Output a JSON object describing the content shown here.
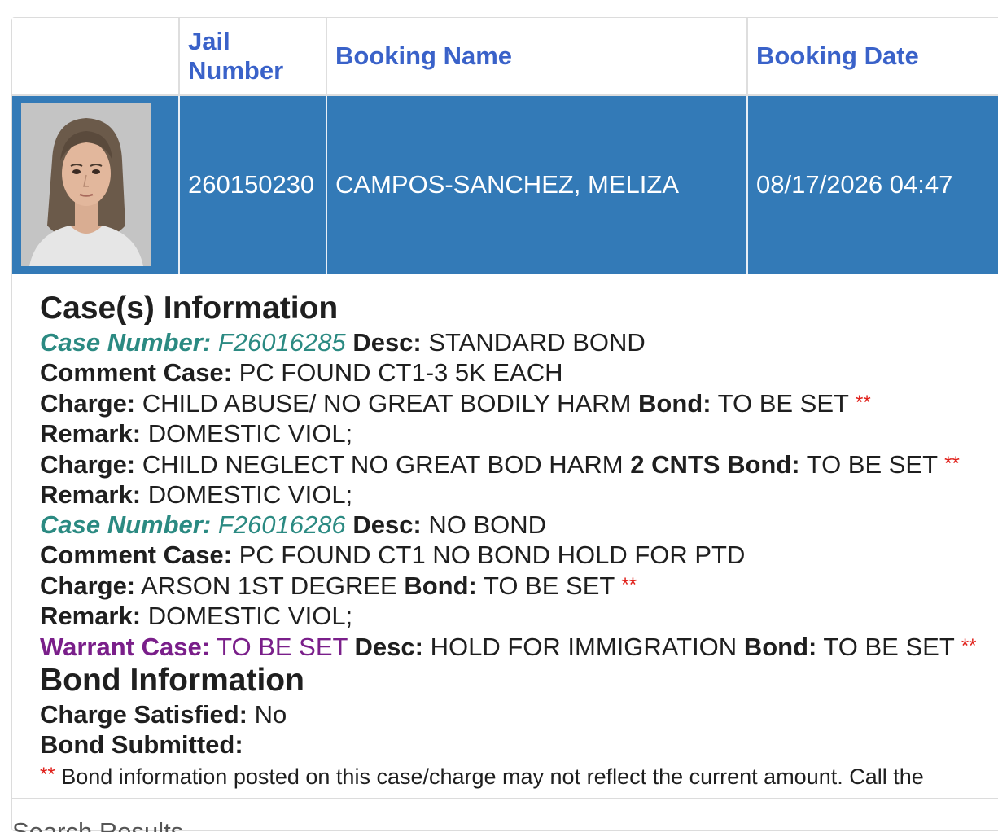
{
  "table": {
    "headers": [
      "",
      "Jail Number",
      "Booking Name",
      "Booking Date"
    ],
    "row": {
      "jail_number": "260150230",
      "booking_name": "CAMPOS-SANCHEZ, MELIZA",
      "booking_date": "08/17/2026 04:47"
    }
  },
  "cases_section": {
    "title": "Case(s) Information",
    "lines": [
      {
        "kind": "case",
        "label": "Case Number:",
        "value": "F26016285",
        "desc_label": "Desc:",
        "desc": "STANDARD BOND"
      },
      {
        "kind": "comment",
        "label": "Comment Case:",
        "value": "PC FOUND CT1-3 5K EACH"
      },
      {
        "kind": "charge",
        "label": "Charge:",
        "value": "CHILD ABUSE/ NO GREAT BODILY HARM",
        "counts": "",
        "bond_label": "Bond:",
        "bond": "TO BE SET",
        "stars": "**"
      },
      {
        "kind": "remark",
        "label": "Remark:",
        "value": "DOMESTIC VIOL;"
      },
      {
        "kind": "charge",
        "label": "Charge:",
        "value": "CHILD NEGLECT NO GREAT BOD HARM",
        "counts": "2 CNTS",
        "bond_label": "Bond:",
        "bond": "TO BE SET",
        "stars": "**"
      },
      {
        "kind": "remark",
        "label": "Remark:",
        "value": "DOMESTIC VIOL;"
      },
      {
        "kind": "case",
        "label": "Case Number:",
        "value": "F26016286",
        "desc_label": "Desc:",
        "desc": "NO BOND"
      },
      {
        "kind": "comment",
        "label": "Comment Case:",
        "value": "PC FOUND CT1 NO BOND HOLD FOR PTD"
      },
      {
        "kind": "charge",
        "label": "Charge:",
        "value": "ARSON 1ST DEGREE",
        "counts": "",
        "bond_label": "Bond:",
        "bond": "TO BE SET",
        "stars": "**"
      },
      {
        "kind": "remark",
        "label": "Remark:",
        "value": "DOMESTIC VIOL;"
      },
      {
        "kind": "warrant",
        "label": "Warrant Case:",
        "value": "TO BE SET",
        "desc_label": "Desc:",
        "desc": "HOLD FOR IMMIGRATION",
        "bond_label": "Bond:",
        "bond": "TO BE SET",
        "stars": "**"
      }
    ]
  },
  "bond_section": {
    "title": "Bond Information",
    "charge_satisfied_label": "Charge Satisfied:",
    "charge_satisfied": "No",
    "bond_submitted_label": "Bond Submitted:",
    "bond_submitted": "",
    "note_stars": "**",
    "note": "Bond information posted on this case/charge may not reflect the current amount. Call the"
  },
  "footer": {
    "label": "Search Results"
  },
  "colors": {
    "header_link": "#3a62c9",
    "selected_row": "#337ab7",
    "case_teal": "#2b8a82",
    "warrant_purple": "#7a1f8a",
    "stars_red": "#e0201a"
  }
}
